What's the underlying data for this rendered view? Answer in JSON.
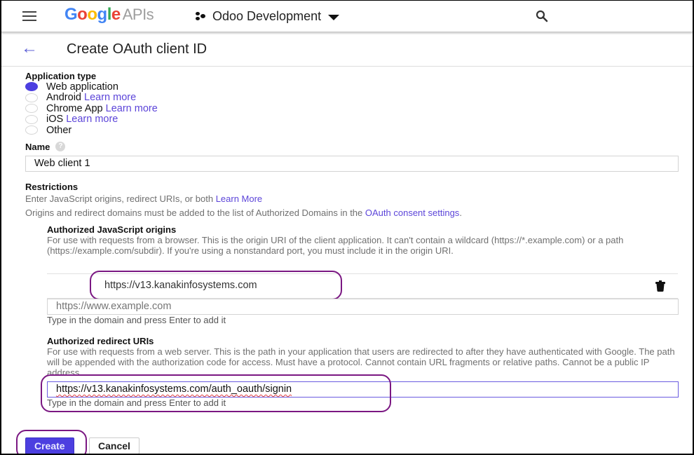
{
  "topbar": {
    "menu_icon": "hamburger-menu-icon",
    "logo_google": "Google",
    "logo_apis": "APIs",
    "project_icon": "project-dots-icon",
    "project_name": "Odoo Development",
    "dropdown_icon": "caret-down-icon",
    "search_icon": "search-icon"
  },
  "header": {
    "back_icon": "arrow-left-icon",
    "back_glyph": "←",
    "title": "Create OAuth client ID"
  },
  "app_type": {
    "label": "Application type",
    "options": [
      {
        "label": "Web application",
        "link": null,
        "checked": true
      },
      {
        "label": "Android",
        "link": "Learn more",
        "checked": false
      },
      {
        "label": "Chrome App",
        "link": "Learn more",
        "checked": false
      },
      {
        "label": "iOS",
        "link": "Learn more",
        "checked": false
      },
      {
        "label": "Other",
        "link": null,
        "checked": false
      }
    ]
  },
  "name": {
    "label": "Name",
    "help_icon": "help-icon",
    "help_glyph": "?",
    "value": "Web client 1"
  },
  "restrictions": {
    "title": "Restrictions",
    "line1": "Enter JavaScript origins, redirect URIs, or both",
    "line1_link": "Learn More",
    "line2": "Origins and redirect domains must be added to the list of Authorized Domains in the",
    "line2_link": "OAuth consent settings",
    "line2_end": "."
  },
  "js_origins": {
    "title": "Authorized JavaScript origins",
    "description": "For use with requests from a browser. This is the origin URI of the client application. It can't contain a wildcard (https://*.example.com) or a path (https://example.com/subdir). If you're using a nonstandard port, you must include it in the origin URI.",
    "entries": [
      "https://v13.kanakinfosystems.com"
    ],
    "delete_icon": "trash-icon",
    "placeholder": "https://www.example.com",
    "hint": "Type in the domain and press Enter to add it"
  },
  "redirect_uris": {
    "title": "Authorized redirect URIs",
    "description": "For use with requests from a web server. This is the path in your application that users are redirected to after they have authenticated with Google. The path will be appended with the authorization code for access. Must have a protocol. Cannot contain URL fragments or relative paths. Cannot be a public IP address.",
    "value": "https://v13.kanakinfosystems.com/auth_oauth/signin",
    "hint": "Type in the domain and press Enter to add it"
  },
  "actions": {
    "create": "Create",
    "cancel": "Cancel"
  },
  "colors": {
    "accent": "#4c3fe0",
    "link": "#5c45d9",
    "annotation": "#7a1782"
  }
}
